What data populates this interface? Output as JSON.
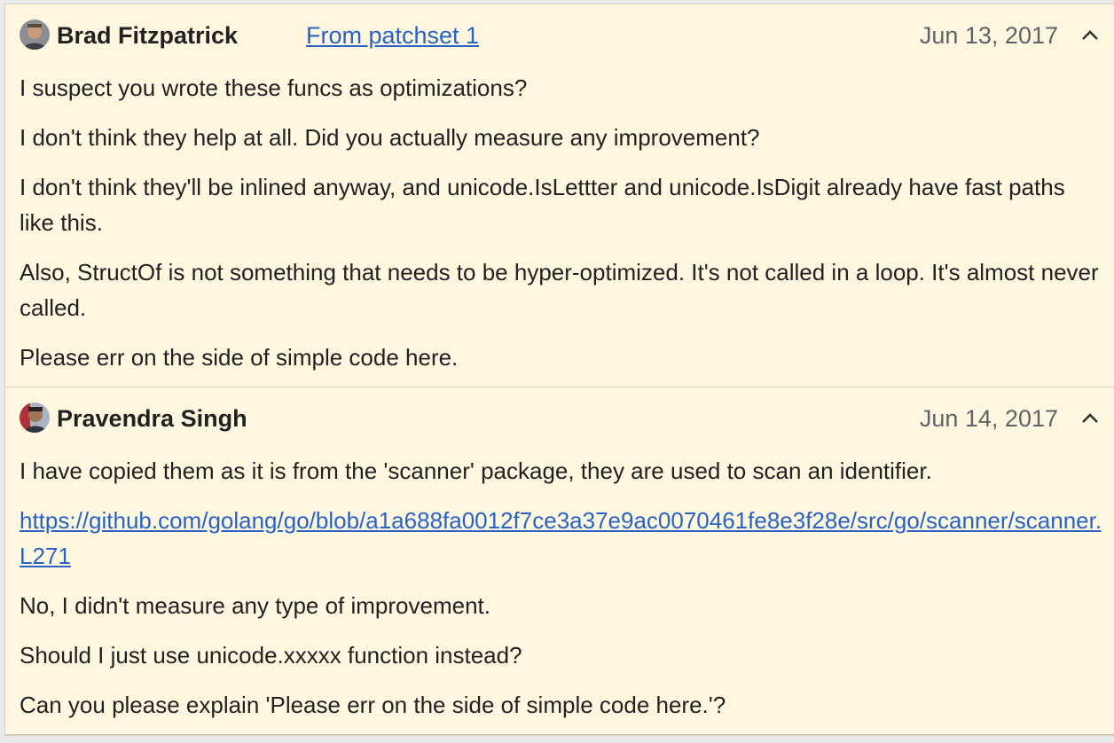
{
  "comments": [
    {
      "author": "Brad Fitzpatrick",
      "patchset_link": "From patchset 1",
      "date": "Jun 13, 2017",
      "collapse_icon": "chevron-up-icon",
      "paragraphs": [
        "I suspect you wrote these funcs as optimizations?",
        "I don't think they help at all. Did you actually measure any improvement?",
        "I don't think they'll be inlined anyway, and unicode.IsLettter and unicode.IsDigit already have fast paths like this.",
        "Also, StructOf is not something that needs to be hyper-optimized. It's not called in a loop. It's almost never called.",
        "Please err on the side of simple code here."
      ]
    },
    {
      "author": "Pravendra Singh",
      "date": "Jun 14, 2017",
      "collapse_icon": "chevron-up-icon",
      "paragraph_1": "I have copied them as it is from the 'scanner' package, they are used to scan an identifier.",
      "link_line_1": "https://github.com/golang/go/blob/a1a688fa0012f7ce3a37e9ac0070461fe8e3f28e/src/go/scanner/scanner.go#",
      "link_line_2": "L271",
      "paragraph_3": "No, I didn't measure any type of improvement.",
      "paragraph_4": "Should I just use unicode.xxxxx function instead?",
      "paragraph_5": "Can you please explain 'Please err on the side of simple code here.'?"
    }
  ],
  "colors": {
    "background": "#fef7e0",
    "link": "#2962c4",
    "date": "#5f6368"
  }
}
